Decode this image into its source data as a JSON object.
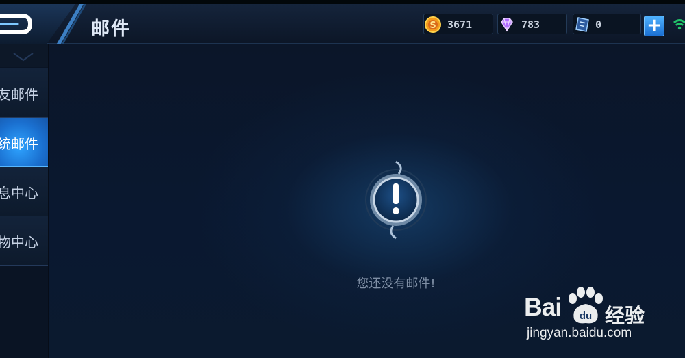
{
  "header": {
    "title": "邮件",
    "resources": [
      {
        "icon": "gold-coin-icon",
        "value": "3671"
      },
      {
        "icon": "purple-diamond-icon",
        "value": "783"
      },
      {
        "icon": "blue-coupon-icon",
        "value": "0"
      }
    ]
  },
  "sidebar": {
    "tabs": [
      {
        "label": "好友邮件",
        "visible_text": "友邮件",
        "active": false
      },
      {
        "label": "系统邮件",
        "visible_text": "统邮件",
        "active": true
      },
      {
        "label": "消息中心",
        "visible_text": "息中心",
        "active": false
      },
      {
        "label": "礼物中心",
        "visible_text": "物中心",
        "active": false
      }
    ]
  },
  "content": {
    "empty_message": "您还没有邮件!",
    "icon": "exclamation-alert-icon"
  },
  "watermark": {
    "brand_left": "Bai",
    "brand_right": "经验",
    "url": "jingyan.baidu.com"
  },
  "colors": {
    "active_tab": "#2ea3ff",
    "background": "#0a1830",
    "accent": "#4fb2ff"
  }
}
